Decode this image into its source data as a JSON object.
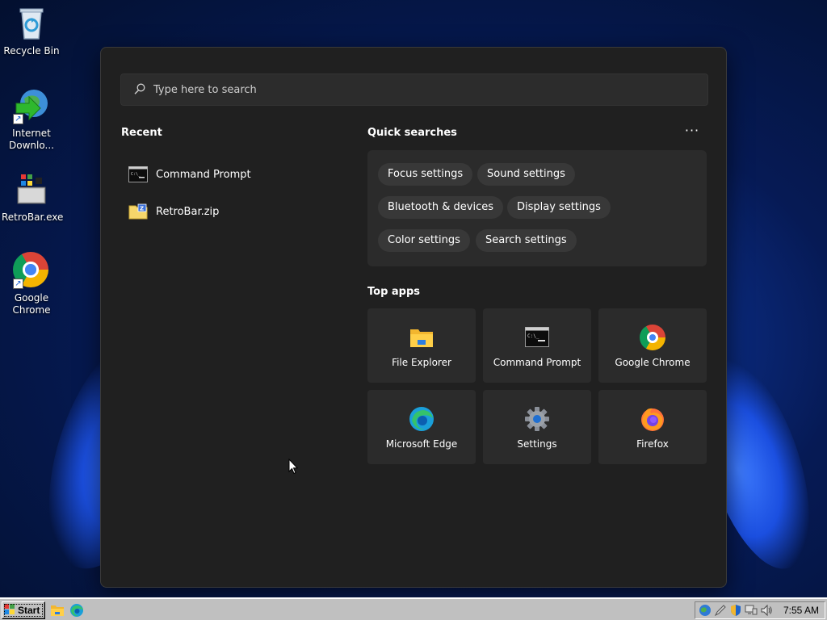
{
  "desktop": {
    "icons": [
      {
        "label": "Recycle Bin",
        "icon": "recycle-bin-icon"
      },
      {
        "label": "Internet Downlo...",
        "icon": "internet-download-manager-icon"
      },
      {
        "label": "RetroBar.exe",
        "icon": "retrobar-icon"
      },
      {
        "label": "Google Chrome",
        "icon": "chrome-icon"
      }
    ]
  },
  "start_menu": {
    "search": {
      "placeholder": "Type here to search",
      "value": ""
    },
    "recent": {
      "title": "Recent",
      "items": [
        {
          "label": "Command Prompt",
          "icon": "command-prompt-icon"
        },
        {
          "label": "RetroBar.zip",
          "icon": "zip-folder-icon"
        }
      ]
    },
    "quick_searches": {
      "title": "Quick searches",
      "more_label": "···",
      "chips": [
        "Focus settings",
        "Sound settings",
        "Bluetooth & devices",
        "Display settings",
        "Color settings",
        "Search settings"
      ]
    },
    "top_apps": {
      "title": "Top apps",
      "apps": [
        {
          "label": "File Explorer",
          "icon": "file-explorer-icon"
        },
        {
          "label": "Command Prompt",
          "icon": "command-prompt-icon"
        },
        {
          "label": "Google Chrome",
          "icon": "chrome-icon"
        },
        {
          "label": "Microsoft Edge",
          "icon": "edge-icon"
        },
        {
          "label": "Settings",
          "icon": "settings-gear-icon"
        },
        {
          "label": "Firefox",
          "icon": "firefox-icon"
        }
      ]
    }
  },
  "taskbar": {
    "start_label": "Start",
    "clock": "7:55 AM"
  },
  "colors": {
    "panel_bg": "#202020",
    "tile_bg": "#2b2b2b",
    "chip_bg": "#383838",
    "taskbar_bg": "#c0c0c0"
  }
}
